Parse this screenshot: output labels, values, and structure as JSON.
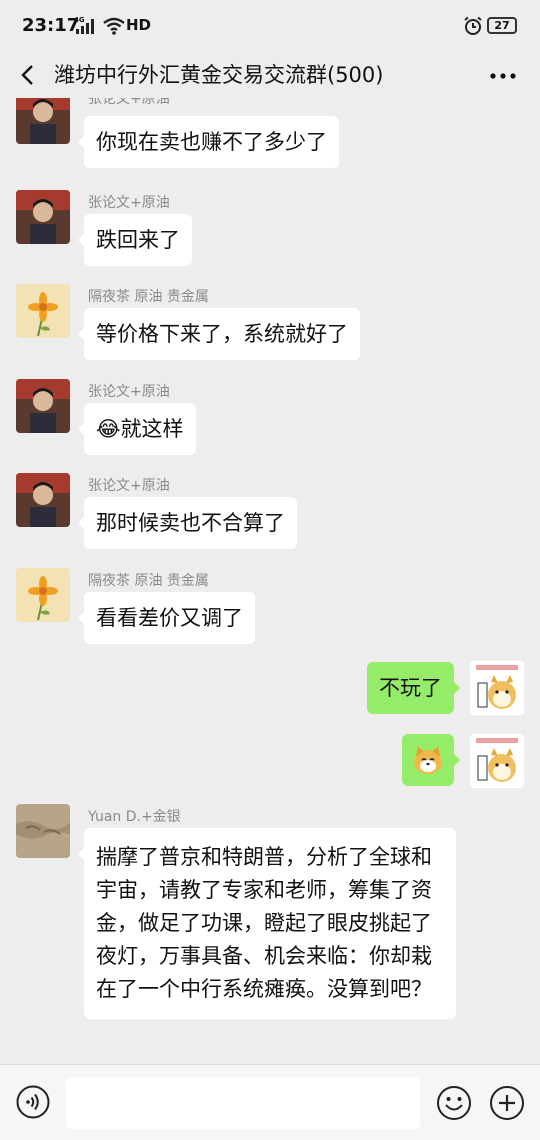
{
  "status_bar": {
    "time": "23:17",
    "network": "4G",
    "hd": "HD",
    "battery": "27"
  },
  "header": {
    "title": "潍坊中行外汇黄金交易交流群(500)"
  },
  "messages": [
    {
      "sender": "张论文+原油",
      "text": "你现在卖也赚不了多少了"
    },
    {
      "sender": "张论文+原油",
      "text": "跌回来了"
    },
    {
      "sender": "隔夜茶   原油  贵金属",
      "text": "等价格下来了，系统就好了"
    },
    {
      "sender": "张论文+原油",
      "emoji": "😂",
      "text": "就这样"
    },
    {
      "sender": "张论文+原油",
      "text": "那时候卖也不合算了"
    },
    {
      "sender": "隔夜茶   原油  贵金属",
      "text": "看看差价又调了"
    },
    {
      "sender": "",
      "text": "不玩了",
      "mine": true
    },
    {
      "sender": "",
      "mine": true,
      "sticker": "shiba-dog"
    },
    {
      "sender": "Yuan D.+金银",
      "text": "揣摩了普京和特朗普，分析了全球和宇宙，请教了专家和老师，筹集了资金，做足了功课，瞪起了眼皮挑起了夜灯，万事具备、机会来临：你却栽在了一个中行系统瘫痪。没算到吧？"
    }
  ],
  "colors": {
    "background": "#ededed",
    "my_bubble": "#95ec69",
    "other_bubble": "#ffffff"
  }
}
